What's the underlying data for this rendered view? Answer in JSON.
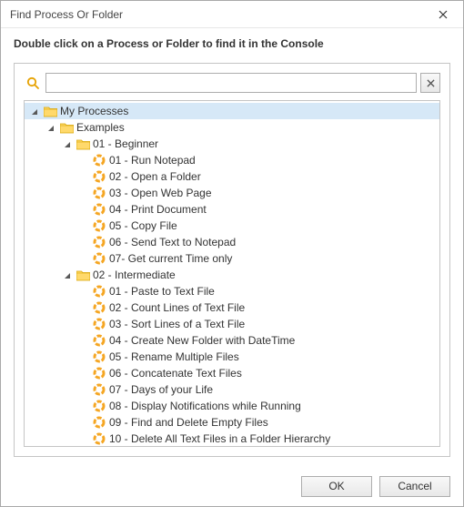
{
  "window": {
    "title": "Find Process Or Folder"
  },
  "instruction": "Double click on a Process or Folder to find it in the Console",
  "search": {
    "value": "",
    "placeholder": ""
  },
  "buttons": {
    "ok": "OK",
    "cancel": "Cancel"
  },
  "tree": {
    "root": {
      "label": "My Processes",
      "selected": true,
      "children": [
        {
          "label": "Examples",
          "children": [
            {
              "label": "01 - Beginner",
              "items": [
                "01 - Run Notepad",
                "02 - Open a Folder",
                "03 - Open Web Page",
                "04 - Print Document",
                "05 - Copy File",
                "06 - Send Text to Notepad",
                "07- Get current Time only"
              ]
            },
            {
              "label": "02 - Intermediate",
              "items": [
                "01 - Paste to Text File",
                "02 - Count Lines of Text File",
                "03 - Sort Lines of a Text File",
                "04 - Create New Folder with DateTime",
                "05 - Rename Multiple Files",
                "06 - Concatenate Text Files",
                "07 - Days of your Life",
                "08 - Display Notifications while Running",
                "09 - Find and Delete Empty Files",
                "10 - Delete All Text Files in a Folder Hierarchy"
              ]
            }
          ]
        }
      ]
    }
  }
}
